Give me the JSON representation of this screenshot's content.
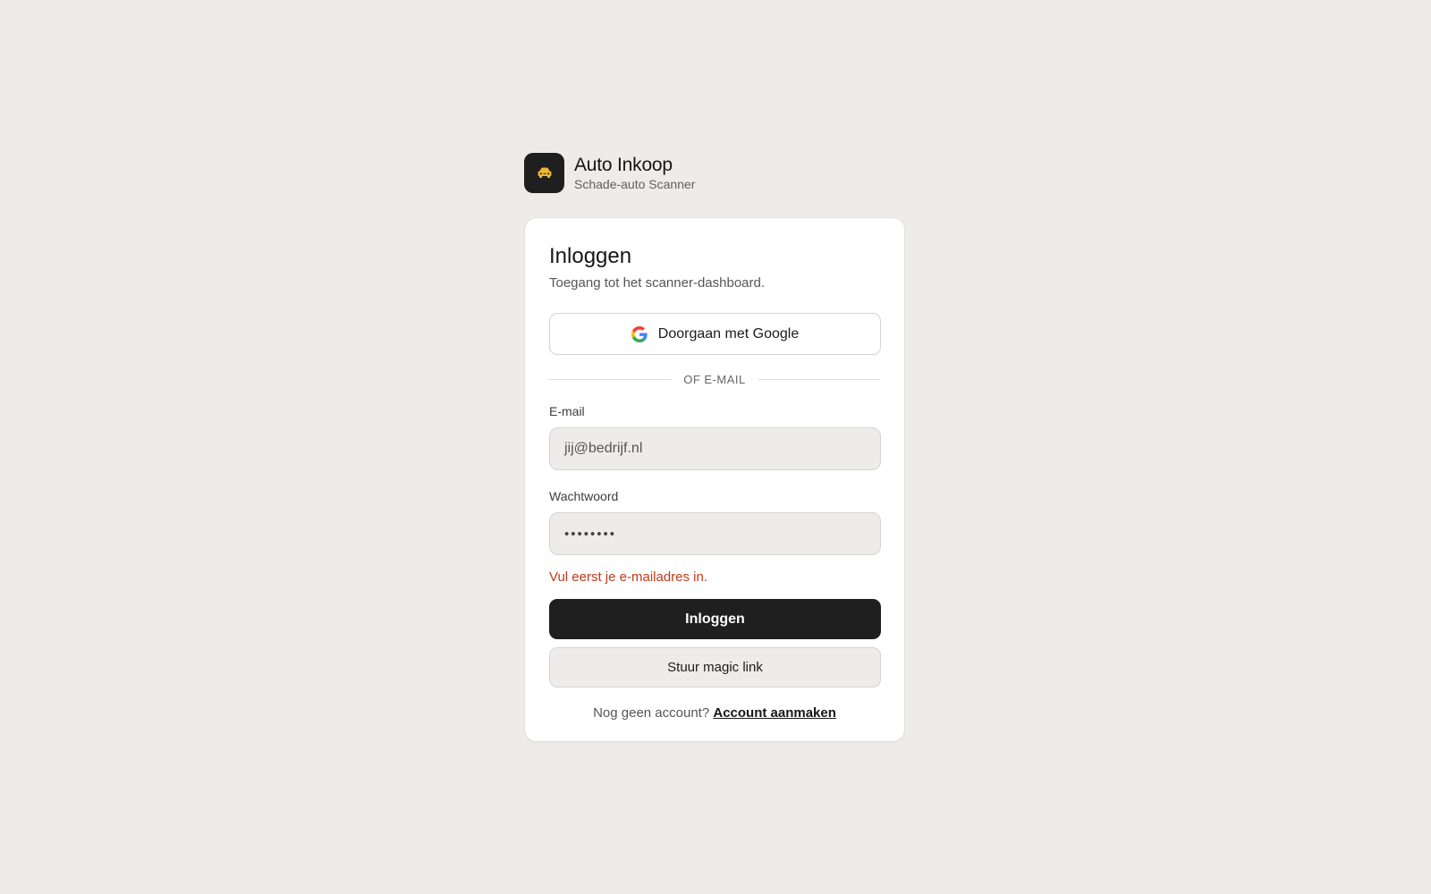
{
  "brand": {
    "title": "Auto Inkoop",
    "subtitle": "Schade-auto Scanner",
    "logo_icon": "car-icon",
    "logo_bg": "#1f1f1f",
    "logo_accent": "#f2b632"
  },
  "login": {
    "title": "Inloggen",
    "subtitle": "Toegang tot het scanner-dashboard.",
    "google_button": "Doorgaan met Google",
    "divider": "OF E-MAIL",
    "email_label": "E-mail",
    "email_value": "jij@bedrijf.nl",
    "password_label": "Wachtwoord",
    "password_value": "••••••••",
    "error": "Vul eerst je e-mailadres in.",
    "submit_button": "Inloggen",
    "magic_link_button": "Stuur magic link",
    "signup_prompt": "Nog geen account?",
    "signup_link": "Account aanmaken"
  },
  "colors": {
    "background": "#edecea",
    "error": "#c0391b",
    "primary_button": "#1f1f1f"
  }
}
